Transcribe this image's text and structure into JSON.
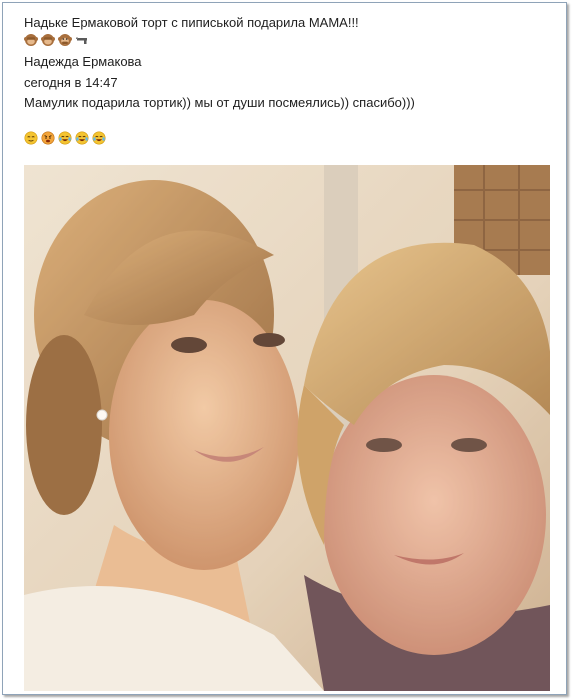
{
  "post": {
    "title": "Надьке Ермаковой торт с пиписькой подарила МАМА!!!",
    "author": "Надежда Ермакова",
    "time": "сегодня в 14:47",
    "message": "Мамулик подарила тортик)) мы от души посмеялись)) спасибо)))"
  },
  "icons": {
    "title_row": [
      "see-no-evil-monkey-icon",
      "see-no-evil-monkey-icon",
      "speak-no-evil-monkey-icon",
      "gun-icon"
    ],
    "message_row": [
      "relieved-face-icon",
      "angry-face-icon",
      "tears-of-joy-face-icon",
      "tears-of-joy-face-icon",
      "tears-of-joy-face-icon"
    ]
  },
  "colors": {
    "frame_border": "#8fa3b8",
    "emoji_yellow": "#f4c431",
    "monkey_brown": "#a86f3d"
  }
}
